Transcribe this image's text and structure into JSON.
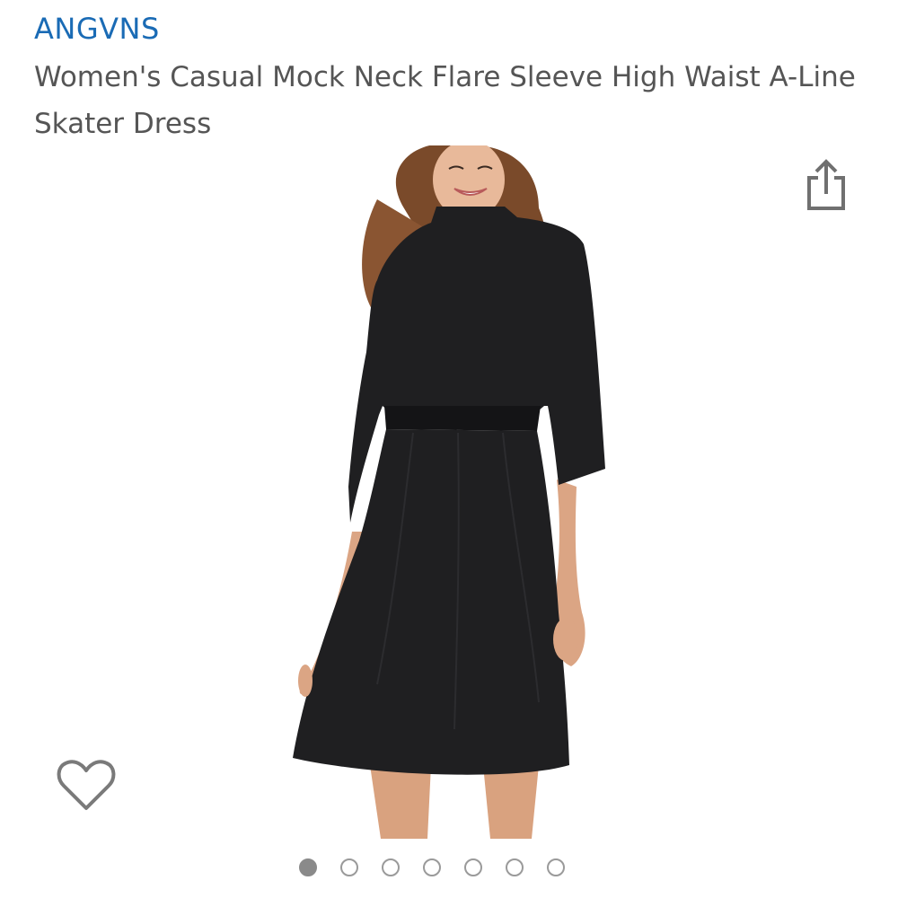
{
  "product": {
    "brand": "ANGVNS",
    "title": "Women's Casual Mock Neck Flare Sleeve High Waist A-Line Skater Dress"
  },
  "icons": {
    "share": "share-icon",
    "wishlist": "heart-outline-icon"
  },
  "carousel": {
    "total_images": 7,
    "active_index": 0
  },
  "colors": {
    "brand_link": "#1a6bb5",
    "title_text": "#555555",
    "dot_active": "#8a8a8a",
    "dot_inactive_border": "#9a9a9a",
    "dress": "#1f1f21"
  }
}
